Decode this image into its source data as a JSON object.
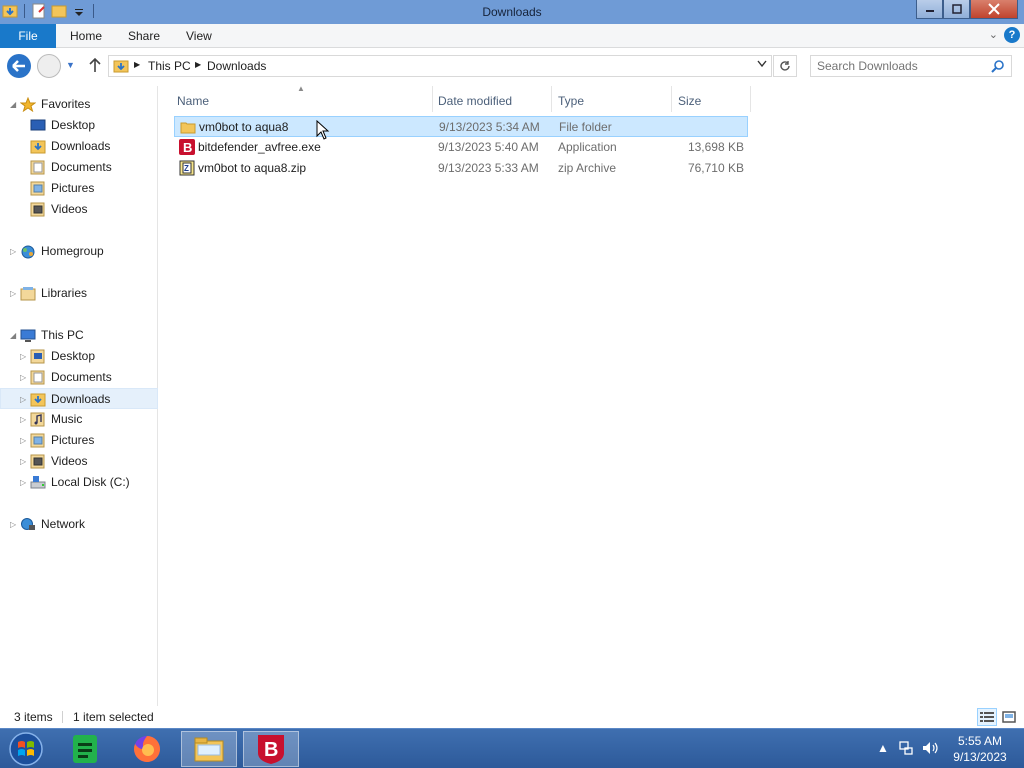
{
  "window": {
    "title": "Downloads"
  },
  "ribbon": {
    "tabs": [
      "File",
      "Home",
      "Share",
      "View"
    ],
    "help": "?"
  },
  "nav": {
    "breadcrumb": [
      "This PC",
      "Downloads"
    ],
    "search_placeholder": "Search Downloads"
  },
  "tree": {
    "favorites": {
      "label": "Favorites",
      "items": [
        "Desktop",
        "Downloads",
        "Documents",
        "Pictures",
        "Videos"
      ]
    },
    "homegroup": "Homegroup",
    "libraries": "Libraries",
    "thispc": {
      "label": "This PC",
      "items": [
        "Desktop",
        "Documents",
        "Downloads",
        "Music",
        "Pictures",
        "Videos",
        "Local Disk (C:)"
      ]
    },
    "network": "Network"
  },
  "columns": {
    "name": "Name",
    "date": "Date modified",
    "type": "Type",
    "size": "Size"
  },
  "files": [
    {
      "name": "vm0bot to aqua8",
      "date": "9/13/2023 5:34 AM",
      "type": "File folder",
      "size": "",
      "icon": "folder-icon",
      "selected": true
    },
    {
      "name": "bitdefender_avfree.exe",
      "date": "9/13/2023 5:40 AM",
      "type": "Application",
      "size": "13,698 KB",
      "icon": "bitdefender-icon",
      "selected": false
    },
    {
      "name": "vm0bot to aqua8.zip",
      "date": "9/13/2023 5:33 AM",
      "type": "zip Archive",
      "size": "76,710 KB",
      "icon": "zip-icon",
      "selected": false
    }
  ],
  "status": {
    "count": "3 items",
    "selection": "1 item selected"
  },
  "taskbar": {
    "time": "5:55 AM",
    "date": "9/13/2023"
  },
  "colors": {
    "accent": "#1979ca",
    "selection": "#cce8ff",
    "taskbar": "#2d5a9a"
  }
}
